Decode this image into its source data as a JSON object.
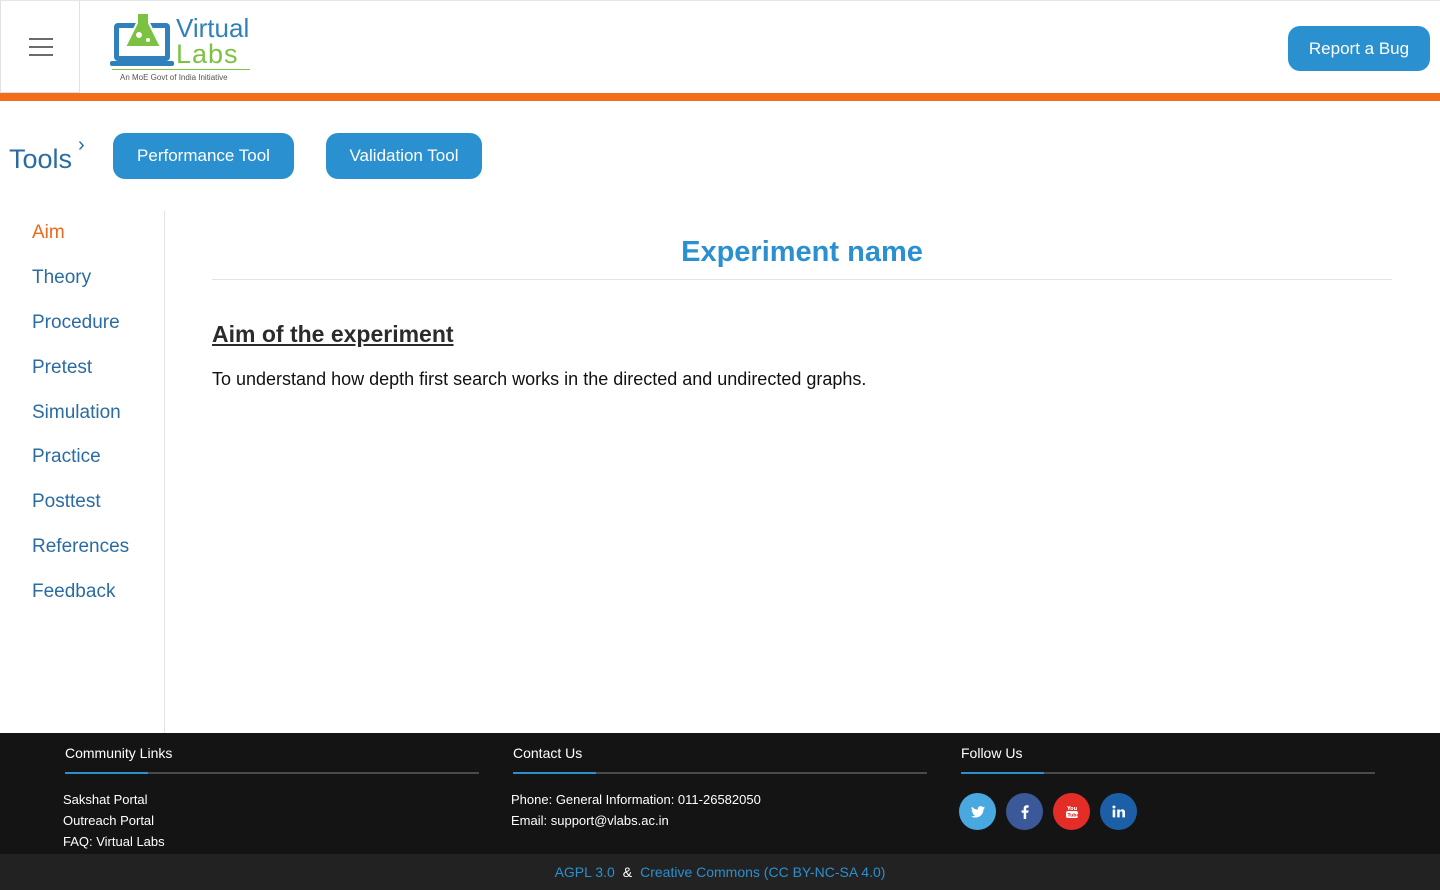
{
  "header": {
    "logo": {
      "line1": "Virtual",
      "line2": "Labs",
      "tagline": "An MoE Govt of India Initiative"
    },
    "report_bug_label": "Report a Bug"
  },
  "tools": {
    "label": "Tools",
    "chevron": "›",
    "buttons": [
      "Performance Tool",
      "Validation Tool"
    ]
  },
  "sidebar": {
    "items": [
      {
        "label": "Aim",
        "active": true
      },
      {
        "label": "Theory",
        "active": false
      },
      {
        "label": "Procedure",
        "active": false
      },
      {
        "label": "Pretest",
        "active": false
      },
      {
        "label": "Simulation",
        "active": false
      },
      {
        "label": "Practice",
        "active": false
      },
      {
        "label": "Posttest",
        "active": false
      },
      {
        "label": "References",
        "active": false
      },
      {
        "label": "Feedback",
        "active": false
      }
    ]
  },
  "main": {
    "title": "Experiment name",
    "section_heading": "Aim of the experiment",
    "section_text": "To understand how depth first search works in the directed and undirected graphs."
  },
  "footer": {
    "community": {
      "heading": "Community Links",
      "links": [
        "Sakshat Portal",
        "Outreach Portal",
        "FAQ: Virtual Labs"
      ]
    },
    "contact": {
      "heading": "Contact Us",
      "phone": "Phone: General Information: 011-26582050",
      "email": "Email: support@vlabs.ac.in"
    },
    "follow": {
      "heading": "Follow Us",
      "icons": [
        "twitter-icon",
        "facebook-icon",
        "youtube-icon",
        "linkedin-icon"
      ]
    },
    "license": {
      "agpl": "AGPL 3.0",
      "amp": "&",
      "cc": "Creative Commons (CC BY-NC-SA 4.0)"
    }
  },
  "colors": {
    "accent": "#2a90cf",
    "orange": "#f26e18",
    "nav_text": "#2a6ca2",
    "active_nav": "#e8691f",
    "footer_bg": "#141414"
  }
}
